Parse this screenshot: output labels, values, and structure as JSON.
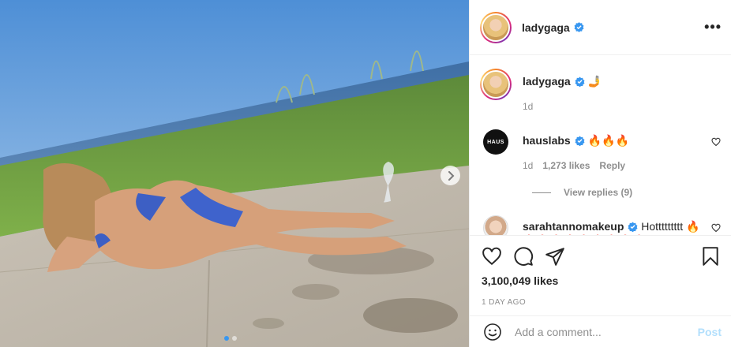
{
  "post": {
    "username": "ladygaga",
    "more_label": "•••"
  },
  "caption": {
    "username": "ladygaga",
    "text": " 🤳",
    "time": "1d"
  },
  "comments": [
    {
      "username": "hauslabs",
      "avatar_text": "HAUS",
      "text": " 🔥🔥🔥",
      "time": "1d",
      "likes": "1,273 likes",
      "reply_label": "Reply",
      "view_replies": "View replies (9)"
    },
    {
      "username": "sarahtannomakeup",
      "text": " Hottttttttt 🔥🔥🔥🔥🔥🔥🔥🔥🔥🔥"
    }
  ],
  "footer": {
    "likes": "3,100,049 likes",
    "time_ago": "1 DAY AGO",
    "comment_placeholder": "Add a comment...",
    "post_label": "Post"
  },
  "colors": {
    "accent": "#3897f0",
    "verified": "#3897f0",
    "post_disabled": "#b2dffc",
    "secondary_text": "#8e8e8e"
  },
  "icons": [
    "next-chevron-icon",
    "verified-badge-icon",
    "more-options-icon",
    "heart-icon",
    "comment-icon",
    "share-icon",
    "bookmark-icon",
    "emoji-icon"
  ],
  "carousel": {
    "slide_count": 2,
    "active_index": 0
  }
}
